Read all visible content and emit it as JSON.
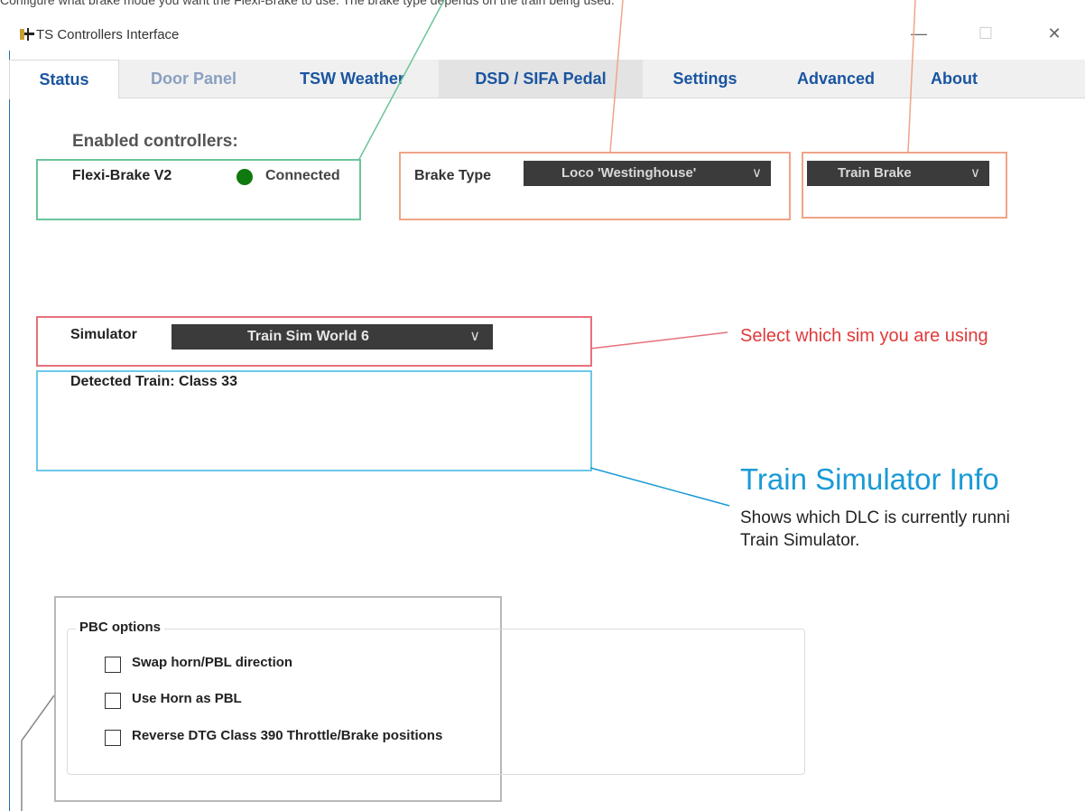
{
  "top_caption": "Configure what brake mode you want the Flexi-Brake to use. The brake type depends on the train being used.",
  "window": {
    "title": "TS Controllers Interface",
    "minimize": "—",
    "maximize": "☐",
    "close": "✕"
  },
  "tabs": [
    {
      "label": "Status"
    },
    {
      "label": "Door Panel"
    },
    {
      "label": "TSW Weather"
    },
    {
      "label": "DSD / SIFA Pedal"
    },
    {
      "label": "Settings"
    },
    {
      "label": "Advanced"
    },
    {
      "label": "About"
    }
  ],
  "status": {
    "enabled_heading": "Enabled controllers:",
    "controller_name": "Flexi-Brake V2",
    "controller_status": "Connected",
    "status_color": "#0f7a0f",
    "brake_type_label": "Brake Type",
    "brake_type_value": "Loco 'Westinghouse'",
    "brake_mode_value": "Train Brake",
    "simulator_label": "Simulator",
    "simulator_value": "Train Sim World 6",
    "detected_train": "Detected Train: Class 33"
  },
  "pbc": {
    "title": "PBC options",
    "options": [
      {
        "label": "Swap horn/PBL direction",
        "checked": false
      },
      {
        "label": "Use Horn as PBL",
        "checked": false
      },
      {
        "label": "Reverse DTG Class 390 Throttle/Brake positions",
        "checked": false
      }
    ]
  },
  "annotations": {
    "simulator_note": "Select which sim you are using",
    "info_title": "Train Simulator Info",
    "info_line1": "Shows which DLC is currently runni",
    "info_line2": "Train Simulator."
  },
  "colors": {
    "green": "#6cc49a",
    "orange": "#f0a488",
    "red": "#e8707a",
    "cyan": "#6cc8e8",
    "gray": "#b8b8b8",
    "accent_blue": "#1a9ad6",
    "note_red": "#e03a3a"
  }
}
